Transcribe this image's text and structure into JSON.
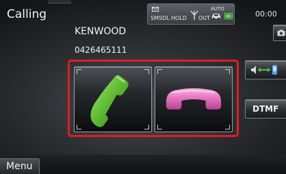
{
  "header": {
    "title": "Calling",
    "status": {
      "sms": "SMS",
      "dl": "DL",
      "hold": "HOLD",
      "out": "OUT",
      "auto": "AUTO"
    },
    "clock": "00:00"
  },
  "caller": {
    "name": "KENWOOD",
    "number": "0426465111"
  },
  "side_buttons": {
    "dtmf_label": "DTMF"
  },
  "footer": {
    "menu_label": "Menu"
  },
  "colors": {
    "answer": "#55b82f",
    "hangup": "#e46fbe",
    "highlight": "#e11d25",
    "transfer_arrow": "#3fc45a"
  },
  "icons": {
    "answer": "phone-answer-icon",
    "hangup": "phone-hangup-icon",
    "camera": "camera-icon",
    "transfer": "voice-transfer-icon",
    "message": "envelope-icon",
    "signal": "signal-icon",
    "car": "car-icon",
    "battery": "battery-icon"
  }
}
